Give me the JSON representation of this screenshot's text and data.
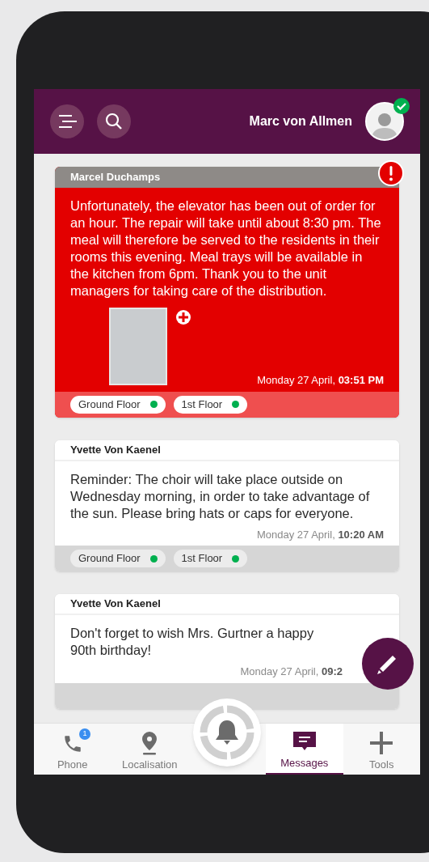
{
  "header": {
    "user_name": "Marc von Allmen",
    "online": true
  },
  "messages": [
    {
      "author": "Marcel Duchamps",
      "urgent": true,
      "text": "Unfortunately, the elevator has been out of order for an hour. The repair will take until about 8:30 pm. The meal will therefore be served to the residents in their rooms this evening. Meal trays will be available in the kitchen from 6pm. Thank you to the unit managers for taking care of the distribution.",
      "has_image": true,
      "date": "Monday 27 April,",
      "time": "03:51 PM",
      "tags": [
        {
          "label": "Ground Floor",
          "color": "#00b04f"
        },
        {
          "label": "1st Floor",
          "color": "#00b04f"
        }
      ]
    },
    {
      "author": "Yvette Von Kaenel",
      "urgent": false,
      "text": "Reminder: The choir will take place outside on Wednesday morning, in order to take advantage of the sun. Please bring hats or caps for everyone.",
      "has_image": false,
      "date": "Monday 27 April,",
      "time": "10:20 AM",
      "tags": [
        {
          "label": "Ground Floor",
          "color": "#00b04f"
        },
        {
          "label": "1st Floor",
          "color": "#00b04f"
        }
      ]
    },
    {
      "author": "Yvette Von Kaenel",
      "urgent": false,
      "text": "Don't forget to wish Mrs. Gurtner a happy 90th birthday!",
      "has_image": false,
      "date": "Monday 27 April,",
      "time": "09:2"
    }
  ],
  "nav": [
    {
      "kind": "phone",
      "label": "Phone",
      "selected": false,
      "badge": "1"
    },
    {
      "kind": "location",
      "label": "Localisation",
      "selected": false
    },
    {
      "kind": "alarm"
    },
    {
      "kind": "messages",
      "label": "Messages",
      "selected": true
    },
    {
      "kind": "tools",
      "label": "Tools",
      "selected": false
    }
  ]
}
